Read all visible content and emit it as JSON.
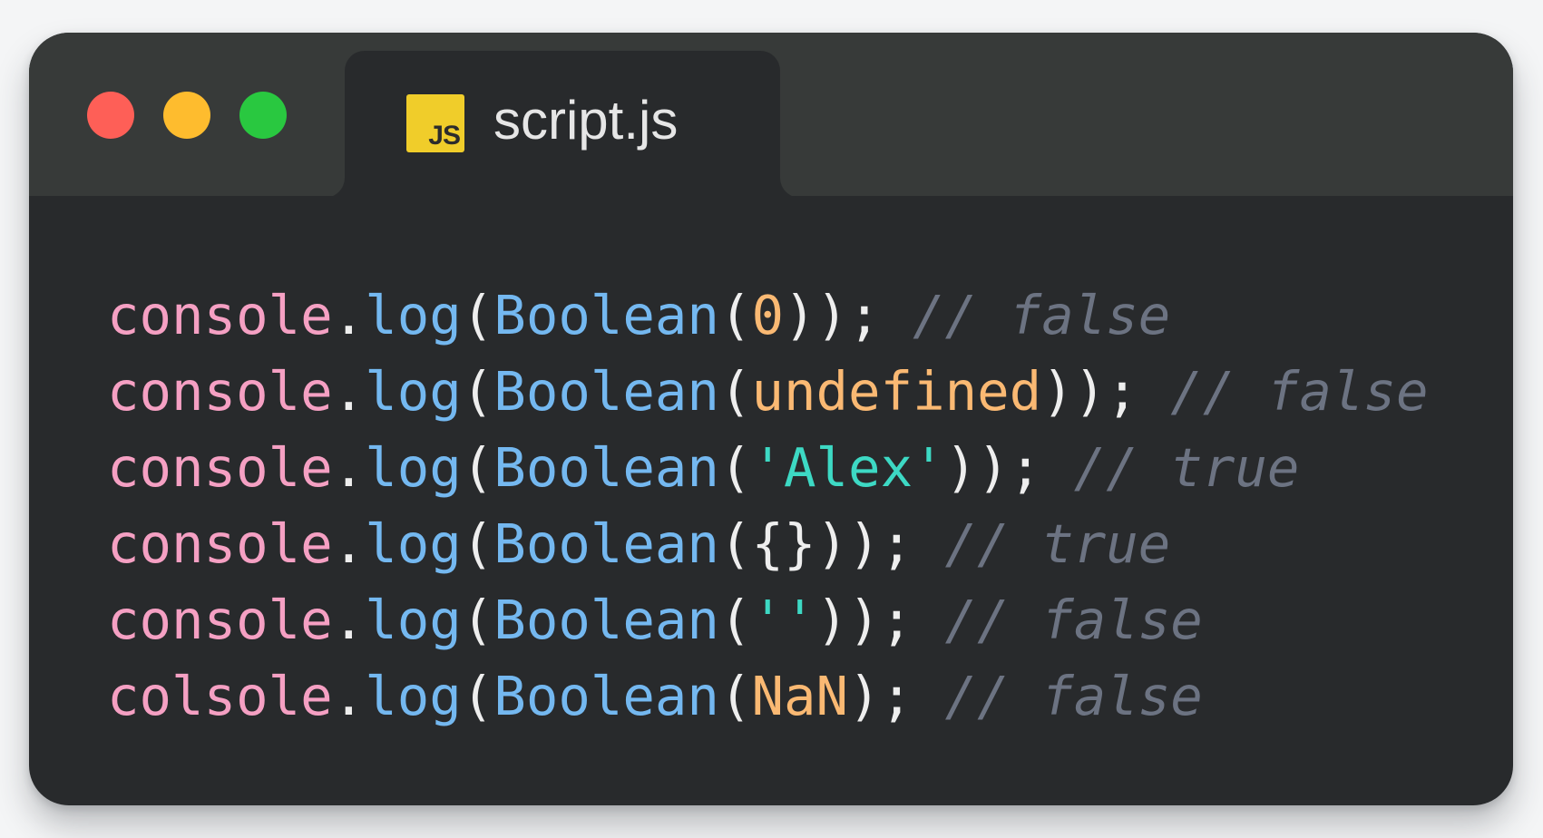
{
  "window": {
    "controls": [
      "close",
      "minimize",
      "maximize"
    ],
    "tab": {
      "badge": "JS",
      "title": "script.js"
    }
  },
  "colors": {
    "close": "#fe5f57",
    "minimize": "#febc2e",
    "maximize": "#29c840",
    "badge": "#f0cd2a",
    "object": "#f5a0c3",
    "function": "#74b8f0",
    "number_literal": "#fab973",
    "string_literal": "#3dd9c4",
    "comment": "#6c7382"
  },
  "code": {
    "lines": [
      {
        "obj": "console",
        "dot": ".",
        "method": "log",
        "open1": "(",
        "fn": "Boolean",
        "open2": "(",
        "arg": "0",
        "close": "))",
        "semi": ";",
        "sp": " ",
        "comment": "// false"
      },
      {
        "obj": "console",
        "dot": ".",
        "method": "log",
        "open1": "(",
        "fn": "Boolean",
        "open2": "(",
        "arg": "undefined",
        "close": "))",
        "semi": ";",
        "sp": " ",
        "comment": "// false"
      },
      {
        "obj": "console",
        "dot": ".",
        "method": "log",
        "open1": "(",
        "fn": "Boolean",
        "open2": "(",
        "arg": "'Alex'",
        "close": "))",
        "semi": ";",
        "sp": " ",
        "comment": "// true"
      },
      {
        "obj": "console",
        "dot": ".",
        "method": "log",
        "open1": "(",
        "fn": "Boolean",
        "open2": "(",
        "arg": "{}",
        "close": "))",
        "semi": ";",
        "sp": " ",
        "comment": "// true"
      },
      {
        "obj": "console",
        "dot": ".",
        "method": "log",
        "open1": "(",
        "fn": "Boolean",
        "open2": "(",
        "arg": "''",
        "close": "))",
        "semi": ";",
        "sp": " ",
        "comment": "// false"
      },
      {
        "obj": "colsole",
        "dot": ".",
        "method": "log",
        "open1": "(",
        "fn": "Boolean",
        "open2": "(",
        "arg": "NaN",
        "close": ")",
        "semi": ";",
        "sp": " ",
        "comment": "// false"
      }
    ]
  }
}
